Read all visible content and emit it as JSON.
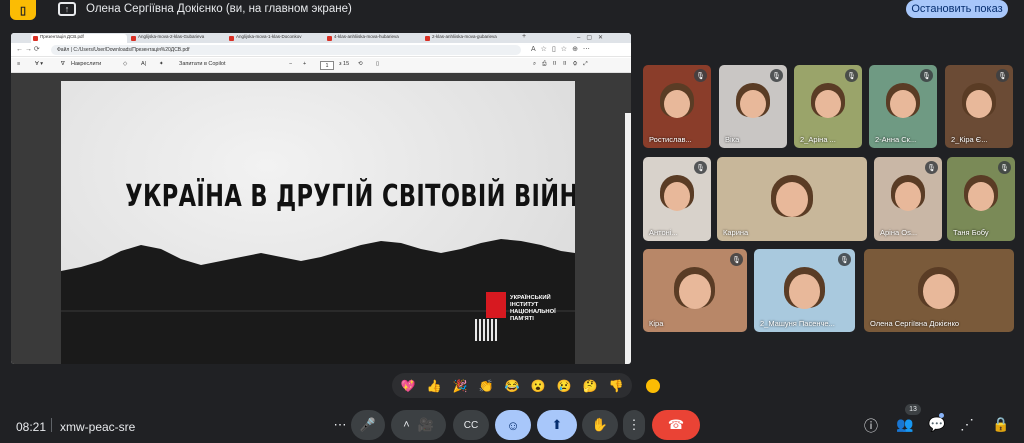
{
  "meeting": {
    "presenter_label": "Олена Сергіївна Докієнко (ви, на главном экране)",
    "stop_button": "Остановить показ",
    "time": "08:21",
    "code": "xmw-peac-sre",
    "participant_count": "13"
  },
  "browser": {
    "tabs": [
      {
        "label": "Презентація ДСВ.pdf",
        "active": true
      },
      {
        "label": "Anglijska-mova-2-klas-Gubarieva",
        "active": false
      },
      {
        "label": "Anglijska-mova-1-klas-Doconkov",
        "active": false
      },
      {
        "label": "4-klas-anhliiska-mova-hubarieva",
        "active": false
      },
      {
        "label": "2-klas-anhliiska-mova-gubarieva",
        "active": false
      }
    ],
    "address_prefix": "Файл",
    "address": "C:/Users/User/Downloads/Презентація%20ДСВ.pdf",
    "pdf_toolbar": {
      "draw": "Накреслити",
      "copilot": "Запитати в Copilot",
      "zoom_minus": "−",
      "zoom_plus": "+",
      "page": "1",
      "page_total": "з 15"
    }
  },
  "slide": {
    "title": "УКРАЇНА В ДРУГІЙ СВІТОВІЙ ВІЙНІ",
    "institute": "УКРАЇНСЬКИЙ\nІНСТИТУТ\nНАЦІОНАЛЬНОЇ\nПАМ'ЯТІ"
  },
  "participants": [
    {
      "name": "Ростислав...",
      "bg": "#8a3d2a",
      "muted": true
    },
    {
      "name": "Віка",
      "bg": "#c9c6c4",
      "muted": true
    },
    {
      "name": "2_Аріна ...",
      "bg": "#9aa46a",
      "muted": true
    },
    {
      "name": "2-Анна Ск...",
      "bg": "#6f9a83",
      "muted": true
    },
    {
      "name": "2_Кіра Є...",
      "bg": "#6b4b35",
      "muted": true
    },
    {
      "name": "Антоні...",
      "bg": "#d8d2cb",
      "muted": true
    },
    {
      "name": "Карина",
      "bg": "#c8b79a",
      "muted": false
    },
    {
      "name": "Аріна Os...",
      "bg": "#c9b7a6",
      "muted": true
    },
    {
      "name": "Таня Бобу",
      "bg": "#7a8a57",
      "muted": true
    },
    {
      "name": "Кіра",
      "bg": "#b88768",
      "muted": true
    },
    {
      "name": "2_Машуня Пасенче...",
      "bg": "#a9c9de",
      "muted": true
    },
    {
      "name": "Олена Сергіївна Докієнко",
      "bg": "#7a5a3a",
      "muted": false
    }
  ],
  "reactions": [
    "💖",
    "👍",
    "🎉",
    "👏",
    "😂",
    "😮",
    "😢",
    "🤔",
    "👎"
  ],
  "controls": {
    "more": "⋯",
    "mic": "🎤",
    "camera": "🎥",
    "captions": "CC",
    "emoji": "☺",
    "present": "⬆",
    "hand": "✋",
    "options": "⋮",
    "hangup": "☎",
    "info": "ⓘ",
    "people": "👥",
    "chat": "💬",
    "activities": "⋰",
    "host": "🔒"
  }
}
